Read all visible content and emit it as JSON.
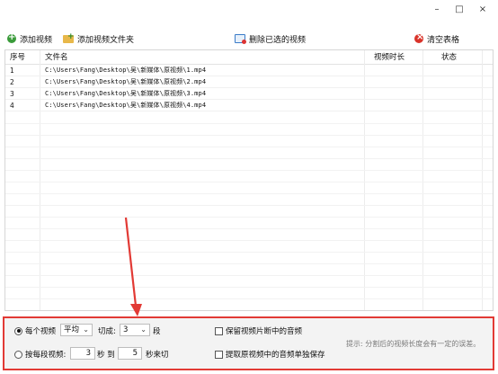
{
  "window": {
    "minimize_glyph": "–",
    "maximize_glyph": "□",
    "close_glyph": "×"
  },
  "toolbar": {
    "add_video": "添加视频",
    "add_folder": "添加视频文件夹",
    "delete_selected": "删除已选的视频",
    "clear_table": "清空表格"
  },
  "table": {
    "columns": [
      "序号",
      "文件名",
      "视频时长",
      "状态"
    ],
    "rows": [
      {
        "no": "1",
        "file": "C:\\Users\\Fang\\Desktop\\吴\\新媒体\\原视频\\1.mp4",
        "duration": "",
        "status": ""
      },
      {
        "no": "2",
        "file": "C:\\Users\\Fang\\Desktop\\吴\\新媒体\\原视频\\2.mp4",
        "duration": "",
        "status": ""
      },
      {
        "no": "3",
        "file": "C:\\Users\\Fang\\Desktop\\吴\\新媒体\\原视频\\3.mp4",
        "duration": "",
        "status": ""
      },
      {
        "no": "4",
        "file": "C:\\Users\\Fang\\Desktop\\吴\\新媒体\\原视频\\4.mp4",
        "duration": "",
        "status": ""
      }
    ]
  },
  "options": {
    "each_video_label": "每个视频",
    "mode_value": "平均",
    "cut_into_label": "切成:",
    "cut_count": "3",
    "segments_suffix": "段",
    "by_segment_label": "按每段视频:",
    "seg_start": "3",
    "to_label": "秒 到",
    "seg_end": "5",
    "seconds_end_label": "秒来切",
    "keep_audio_label": "保留视频片断中的音频",
    "extract_audio_label": "提取原视频中的音频单独保存",
    "hint": "提示: 分割后的视频长度会有一定的误差。",
    "each_video_selected": true,
    "by_segment_selected": false,
    "keep_audio_checked": false,
    "extract_audio_checked": false
  },
  "colors": {
    "highlight_red": "#e23a35",
    "panel_bg": "#f3f3f3"
  }
}
